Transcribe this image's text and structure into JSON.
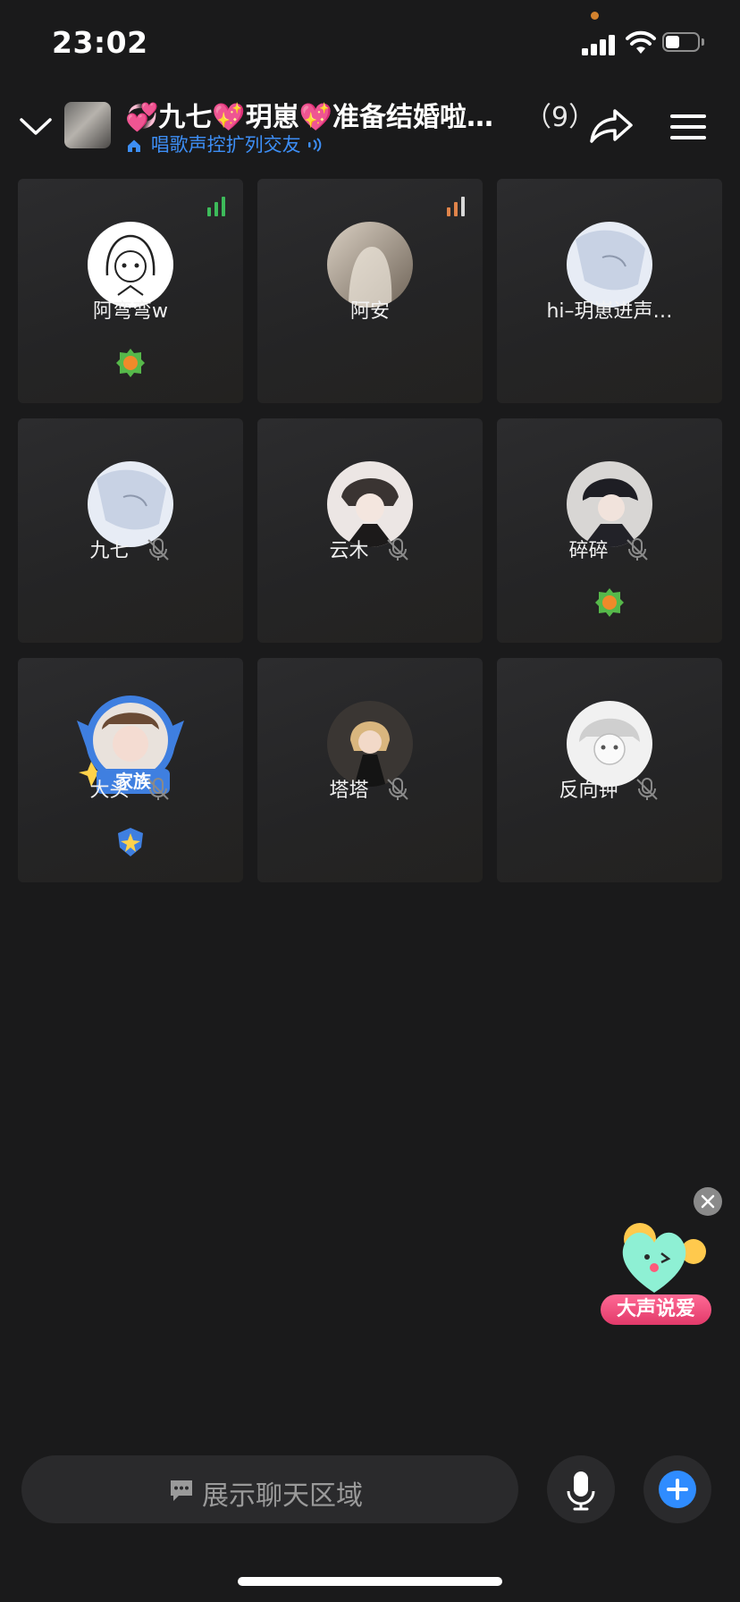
{
  "status_bar": {
    "time": "23:02"
  },
  "header": {
    "title_prefix": "💞九七💖玥崽💖准备结婚啦…",
    "member_count": "（9）",
    "subtitle": "唱歌声控扩列交友"
  },
  "members": [
    {
      "name": "阿弯弯w",
      "muted": false,
      "speaking": "green",
      "badge": "level-badge-icon"
    },
    {
      "name": "阿安",
      "muted": false,
      "speaking": "orange"
    },
    {
      "name": "hi–玥崽进声…",
      "muted": false
    },
    {
      "name": "九七",
      "muted": true
    },
    {
      "name": "云木",
      "muted": true
    },
    {
      "name": "碎碎",
      "muted": true,
      "badge": "level-badge-icon"
    },
    {
      "name": "大头",
      "muted": true,
      "badge": "shield-badge-icon",
      "frame_label": "家族"
    },
    {
      "name": "塔塔",
      "muted": true
    },
    {
      "name": "反向钟",
      "muted": true
    }
  ],
  "promo": {
    "label": "大声说爱"
  },
  "bottom_bar": {
    "chat_placeholder": "展示聊天区域"
  },
  "colors": {
    "accent": "#3d8ef5",
    "signal_green": "#3dbb5a",
    "signal_orange": "#e0844a"
  }
}
